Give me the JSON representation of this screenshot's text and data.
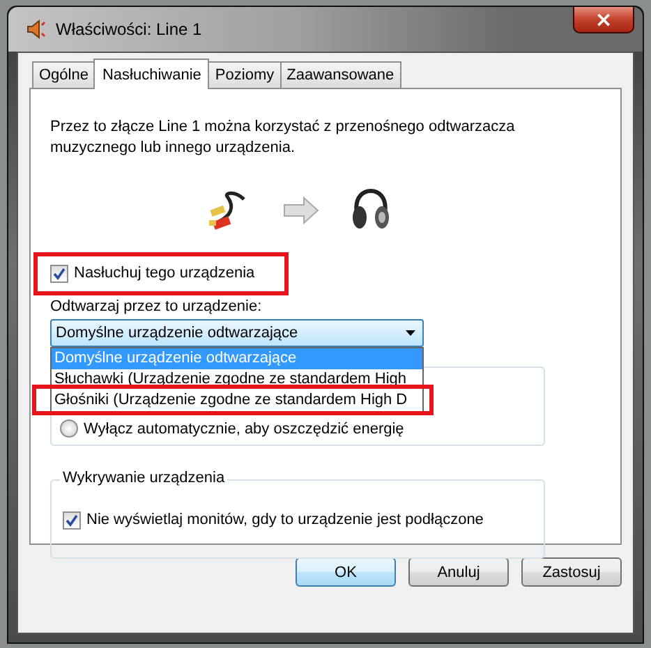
{
  "window": {
    "title": "Właściwości: Line 1",
    "close": "×"
  },
  "tabs": [
    {
      "label": "Ogólne",
      "selected": false
    },
    {
      "label": "Nasłuchiwanie",
      "selected": true
    },
    {
      "label": "Poziomy",
      "selected": false
    },
    {
      "label": "Zaawansowane",
      "selected": false
    }
  ],
  "description": "Przez to złącze Line 1 można korzystać z przenośnego odtwarzacza muzycznego lub innego urządzenia.",
  "listen_checkbox": {
    "label": "Nasłuchuj tego urządzenia",
    "checked": true,
    "highlighted": true
  },
  "playback": {
    "label": "Odtwarzaj przez to urządzenie:",
    "value": "Domyślne urządzenie odtwarzające",
    "options": [
      {
        "label": "Domyślne urządzenie odtwarzające",
        "selected": true,
        "highlighted": false
      },
      {
        "label": "Słuchawki (Urządzenie zgodne ze standardem High",
        "selected": false,
        "highlighted": false
      },
      {
        "label": "Głośniki (Urządzenie zgodne ze standardem High D",
        "selected": false,
        "highlighted": true
      }
    ]
  },
  "power": {
    "radios": [
      {
        "label": "Wyłącz automatycznie, aby oszczędzić energię",
        "selected": false
      }
    ]
  },
  "detection": {
    "title": "Wykrywanie urządzenia",
    "checkbox": {
      "label": "Nie wyświetlaj monitów, gdy to urządzenie jest podłączone",
      "checked": true
    }
  },
  "buttons": [
    {
      "label": "OK",
      "default": true
    },
    {
      "label": "Anuluj",
      "default": false
    },
    {
      "label": "Zastosuj",
      "default": false
    }
  ]
}
